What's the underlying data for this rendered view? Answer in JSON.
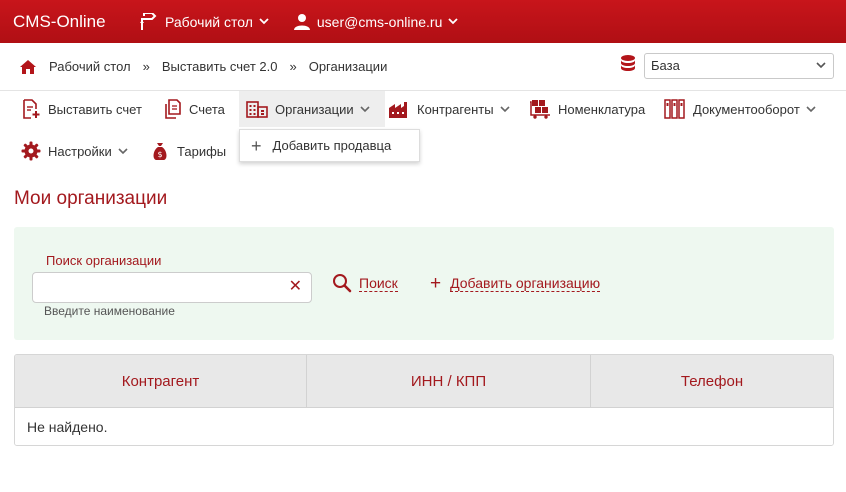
{
  "topbar": {
    "brand": "CMS-Online",
    "desktop_label": "Рабочий стол",
    "user_label": "user@cms-online.ru"
  },
  "breadcrumb": {
    "items": [
      "Рабочий стол",
      "Выставить счет 2.0",
      "Организации"
    ],
    "separator": "»"
  },
  "db_select": {
    "value": "База"
  },
  "menu": {
    "items": [
      {
        "label": "Выставить счет",
        "icon": "document-plus-icon"
      },
      {
        "label": "Счета",
        "icon": "documents-icon"
      },
      {
        "label": "Организации",
        "icon": "building-icon",
        "dropdown": true,
        "active": true
      },
      {
        "label": "Контрагенты",
        "icon": "factory-icon",
        "dropdown": true
      },
      {
        "label": "Номенклатура",
        "icon": "boxes-cart-icon"
      },
      {
        "label": "Документооборот",
        "icon": "binders-icon",
        "dropdown": true
      },
      {
        "label": "Настройки",
        "icon": "gear-icon",
        "dropdown": true
      },
      {
        "label": "Тарифы",
        "icon": "money-bag-icon"
      }
    ],
    "dropdown_item": "Добавить продавца"
  },
  "page": {
    "title": "Мои организации"
  },
  "search": {
    "label": "Поиск организации",
    "value": "",
    "hint": "Введите наименование",
    "search_button": "Поиск",
    "add_button": "Добавить организацию"
  },
  "table": {
    "columns": [
      "Контрагент",
      "ИНН / КПП",
      "Телефон"
    ],
    "empty_text": "Не найдено."
  },
  "colors": {
    "brand_red": "#c8151b",
    "accent_text": "#a3191e",
    "panel_green": "#eef8f0"
  }
}
